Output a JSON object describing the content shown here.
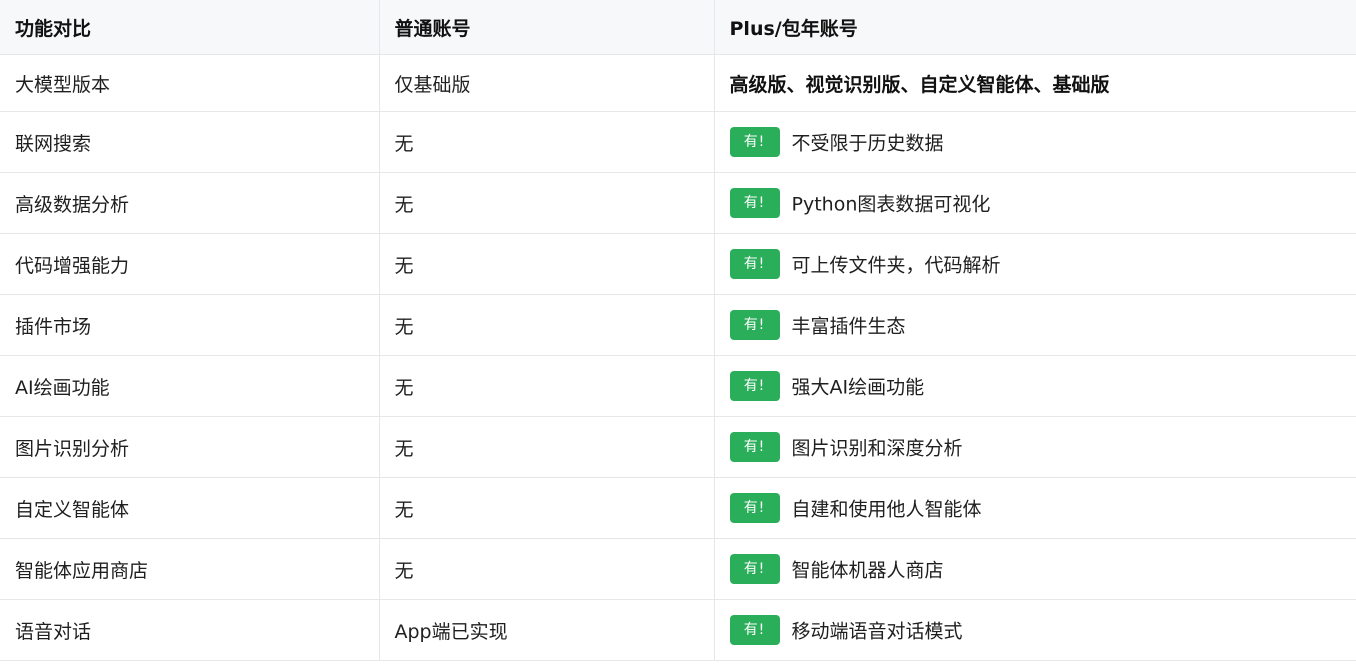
{
  "headers": [
    "功能对比",
    "普通账号",
    "Plus/包年账号"
  ],
  "rows": [
    {
      "feature": "大模型版本",
      "normal": "仅基础版",
      "plus": "高级版、视觉识别版、自定义智能体、基础版"
    },
    {
      "feature": "联网搜索",
      "normal": "无",
      "badge": "有!",
      "plus": "不受限于历史数据"
    },
    {
      "feature": "高级数据分析",
      "normal": "无",
      "badge": "有!",
      "plus": "Python图表数据可视化"
    },
    {
      "feature": "代码增强能力",
      "normal": "无",
      "badge": "有!",
      "plus": "可上传文件夹，代码解析"
    },
    {
      "feature": "插件市场",
      "normal": "无",
      "badge": "有!",
      "plus": "丰富插件生态"
    },
    {
      "feature": "AI绘画功能",
      "normal": "无",
      "badge": "有!",
      "plus": "强大AI绘画功能"
    },
    {
      "feature": "图片识别分析",
      "normal": "无",
      "badge": "有!",
      "plus": "图片识别和深度分析"
    },
    {
      "feature": "自定义智能体",
      "normal": "无",
      "badge": "有!",
      "plus": "自建和使用他人智能体"
    },
    {
      "feature": "智能体应用商店",
      "normal": "无",
      "badge": "有!",
      "plus": "智能体机器人商店"
    },
    {
      "feature": "语音对话",
      "normal": "App端已实现",
      "badge": "有!",
      "plus": "移动端语音对话模式"
    }
  ],
  "colors": {
    "badge": "#2aae5a",
    "header_bg": "#f7f8fa",
    "border": "#e5e7eb"
  }
}
